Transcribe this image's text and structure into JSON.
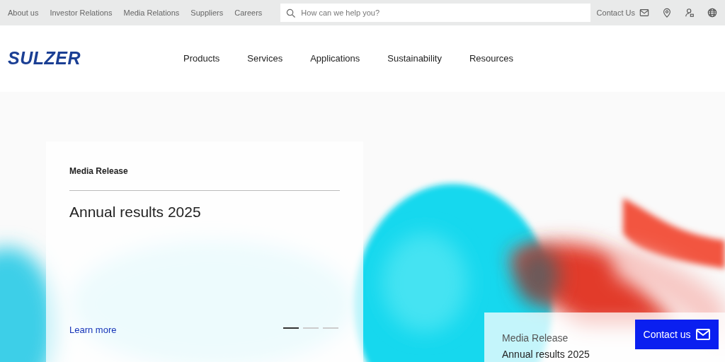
{
  "top_links": [
    "About us",
    "Investor Relations",
    "Media Relations",
    "Suppliers",
    "Careers"
  ],
  "search": {
    "placeholder": "How can we help you?"
  },
  "contact_link": "Contact Us",
  "logo": "SULZER",
  "nav": [
    "Products",
    "Services",
    "Applications",
    "Sustainability",
    "Resources"
  ],
  "hero": {
    "kind": "picture",
    "eyebrow": "Media Release",
    "title": "Annual results 2025",
    "link": "Learn more",
    "slides": [
      {
        "selected": true
      },
      {
        "selected": false
      },
      {
        "selected": false
      }
    ]
  },
  "teaser": {
    "eyebrow": "Media Release",
    "title": "Annual results 2025"
  },
  "contact_button": "Contact us"
}
